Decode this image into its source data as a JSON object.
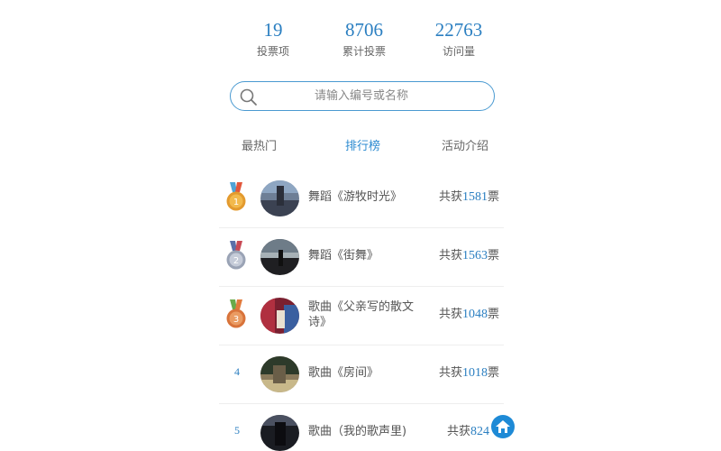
{
  "stats": [
    {
      "value": "19",
      "label": "投票项"
    },
    {
      "value": "8706",
      "label": "累计投票"
    },
    {
      "value": "22763",
      "label": "访问量"
    }
  ],
  "search": {
    "placeholder": "请输入编号或名称"
  },
  "tabs": [
    {
      "label": "最热门",
      "active": false
    },
    {
      "label": "排行榜",
      "active": true
    },
    {
      "label": "活动介绍",
      "active": false
    }
  ],
  "ranking": [
    {
      "rank": "1",
      "medal": "gold",
      "title": "舞蹈《游牧时光》",
      "votes_prefix": "共获",
      "votes": "1581",
      "votes_suffix": "票"
    },
    {
      "rank": "2",
      "medal": "silver",
      "title": "舞蹈《街舞》",
      "votes_prefix": "共获",
      "votes": "1563",
      "votes_suffix": "票"
    },
    {
      "rank": "3",
      "medal": "bronze",
      "title": "歌曲《父亲写的散文诗》",
      "votes_prefix": "共获",
      "votes": "1048",
      "votes_suffix": "票"
    },
    {
      "rank": "4",
      "medal": "",
      "title": "歌曲《房间》",
      "votes_prefix": "共获",
      "votes": "1018",
      "votes_suffix": "票"
    },
    {
      "rank": "5",
      "medal": "",
      "title": "歌曲（我的歌声里)",
      "votes_prefix": "共获",
      "votes": "824",
      "votes_suffix": ""
    }
  ],
  "icons": {
    "search": "search-icon",
    "medal": "medal-icon",
    "floating": "home-icon"
  },
  "colors": {
    "accent": "#2b7fc1",
    "text": "#555555",
    "muted": "#888888",
    "gold": "#e39a2e",
    "silver": "#9aa3b5",
    "bronze": "#d8733a"
  }
}
